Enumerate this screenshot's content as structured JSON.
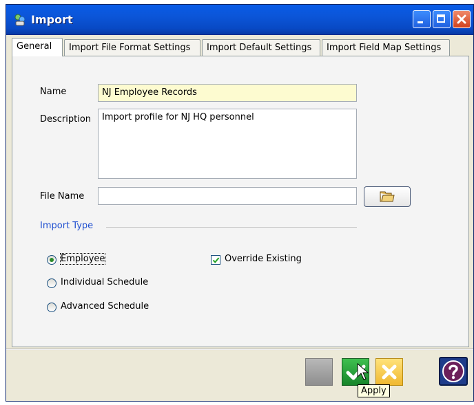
{
  "window": {
    "title": "Import"
  },
  "tabs": [
    {
      "label": "General",
      "active": true
    },
    {
      "label": "Import File Format Settings",
      "active": false
    },
    {
      "label": "Import Default Settings",
      "active": false
    },
    {
      "label": "Import Field Map Settings",
      "active": false
    }
  ],
  "form": {
    "name_label": "Name",
    "name_value": "NJ Employee Records",
    "description_label": "Description",
    "description_value": "Import profile for NJ HQ personnel",
    "file_name_label": "File Name",
    "file_name_value": ""
  },
  "import_type": {
    "title": "Import Type",
    "options": [
      {
        "label": "Employee",
        "selected": true
      },
      {
        "label": "Individual Schedule",
        "selected": false
      },
      {
        "label": "Advanced Schedule",
        "selected": false
      }
    ],
    "override_label": "Override Existing",
    "override_checked": true
  },
  "buttons": {
    "ok_icon": "checkmark-icon",
    "cancel_icon": "x-icon",
    "help_icon": "question-icon"
  },
  "tooltip": {
    "text": "Apply"
  },
  "colors": {
    "titlebar": "#0b55d8",
    "name_field_bg": "#fdfbd0",
    "group_title": "#1f4fd0",
    "ok_button": "#2aa53c",
    "cancel_button": "#f5c84a",
    "help_button": "#1f3c8a"
  }
}
